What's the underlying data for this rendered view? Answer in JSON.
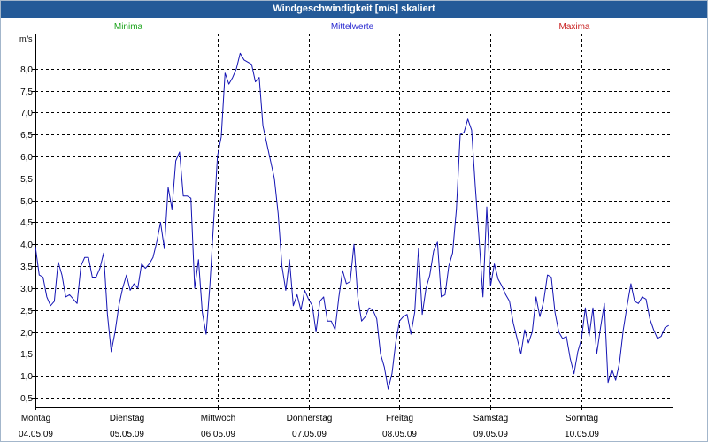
{
  "colors": {
    "title_bar": "#245a98",
    "title_text": "#ffffff",
    "grid": "#000000"
  },
  "chart_data": {
    "type": "line",
    "title": "Windgeschwindigkeit [m/s] skaliert",
    "ylabel": "m/s",
    "grid": true,
    "legend_position": "top",
    "legend": [
      {
        "name": "Minima",
        "color": "#1fa51f"
      },
      {
        "name": "Mittelwerte",
        "color": "#2a2ad0"
      },
      {
        "name": "Maxima",
        "color": "#c82020"
      }
    ],
    "ylim": [
      0.3,
      8.8
    ],
    "yticks": [
      0.5,
      1.0,
      1.5,
      2.0,
      2.5,
      3.0,
      3.5,
      4.0,
      4.5,
      5.0,
      5.5,
      6.0,
      6.5,
      7.0,
      7.5,
      8.0
    ],
    "ytick_labels": [
      "0,5",
      "1,0",
      "1,5",
      "2,0",
      "2,5",
      "3,0",
      "3,5",
      "4,0",
      "4,5",
      "5,0",
      "5,5",
      "6,0",
      "6,5",
      "7,0",
      "7,5",
      "8,0"
    ],
    "xlim": [
      "04.05.09 00:00",
      "11.05.09 00:00"
    ],
    "xticks": [
      {
        "day": "Montag",
        "date": "04.05.09"
      },
      {
        "day": "Dienstag",
        "date": "05.05.09"
      },
      {
        "day": "Mittwoch",
        "date": "06.05.09"
      },
      {
        "day": "Donnerstag",
        "date": "07.05.09"
      },
      {
        "day": "Freitag",
        "date": "08.05.09"
      },
      {
        "day": "Samstag",
        "date": "09.05.09"
      },
      {
        "day": "Sonntag",
        "date": "10.05.09"
      }
    ],
    "x": [
      "04.05.09 00:00",
      "04.05.09 01:00",
      "04.05.09 02:00",
      "04.05.09 03:00",
      "04.05.09 04:00",
      "04.05.09 05:00",
      "04.05.09 06:00",
      "04.05.09 07:00",
      "04.05.09 08:00",
      "04.05.09 09:00",
      "04.05.09 10:00",
      "04.05.09 11:00",
      "04.05.09 12:00",
      "04.05.09 13:00",
      "04.05.09 14:00",
      "04.05.09 15:00",
      "04.05.09 16:00",
      "04.05.09 17:00",
      "04.05.09 18:00",
      "04.05.09 19:00",
      "04.05.09 20:00",
      "04.05.09 21:00",
      "04.05.09 22:00",
      "04.05.09 23:00",
      "05.05.09 00:00",
      "05.05.09 01:00",
      "05.05.09 02:00",
      "05.05.09 03:00",
      "05.05.09 04:00",
      "05.05.09 05:00",
      "05.05.09 06:00",
      "05.05.09 07:00",
      "05.05.09 08:00",
      "05.05.09 09:00",
      "05.05.09 10:00",
      "05.05.09 11:00",
      "05.05.09 12:00",
      "05.05.09 13:00",
      "05.05.09 14:00",
      "05.05.09 15:00",
      "05.05.09 16:00",
      "05.05.09 17:00",
      "05.05.09 18:00",
      "05.05.09 19:00",
      "05.05.09 20:00",
      "05.05.09 21:00",
      "05.05.09 22:00",
      "05.05.09 23:00",
      "06.05.09 00:00",
      "06.05.09 01:00",
      "06.05.09 02:00",
      "06.05.09 03:00",
      "06.05.09 04:00",
      "06.05.09 05:00",
      "06.05.09 06:00",
      "06.05.09 07:00",
      "06.05.09 08:00",
      "06.05.09 09:00",
      "06.05.09 10:00",
      "06.05.09 11:00",
      "06.05.09 12:00",
      "06.05.09 13:00",
      "06.05.09 14:00",
      "06.05.09 15:00",
      "06.05.09 16:00",
      "06.05.09 17:00",
      "06.05.09 18:00",
      "06.05.09 19:00",
      "06.05.09 20:00",
      "06.05.09 21:00",
      "06.05.09 22:00",
      "06.05.09 23:00",
      "07.05.09 00:00",
      "07.05.09 01:00",
      "07.05.09 02:00",
      "07.05.09 03:00",
      "07.05.09 04:00",
      "07.05.09 05:00",
      "07.05.09 06:00",
      "07.05.09 07:00",
      "07.05.09 08:00",
      "07.05.09 09:00",
      "07.05.09 10:00",
      "07.05.09 11:00",
      "07.05.09 12:00",
      "07.05.09 13:00",
      "07.05.09 14:00",
      "07.05.09 15:00",
      "07.05.09 16:00",
      "07.05.09 17:00",
      "07.05.09 18:00",
      "07.05.09 19:00",
      "07.05.09 20:00",
      "07.05.09 21:00",
      "07.05.09 22:00",
      "07.05.09 23:00",
      "08.05.09 00:00",
      "08.05.09 01:00",
      "08.05.09 02:00",
      "08.05.09 03:00",
      "08.05.09 04:00",
      "08.05.09 05:00",
      "08.05.09 06:00",
      "08.05.09 07:00",
      "08.05.09 08:00",
      "08.05.09 09:00",
      "08.05.09 10:00",
      "08.05.09 11:00",
      "08.05.09 12:00",
      "08.05.09 13:00",
      "08.05.09 14:00",
      "08.05.09 15:00",
      "08.05.09 16:00",
      "08.05.09 17:00",
      "08.05.09 18:00",
      "08.05.09 19:00",
      "08.05.09 20:00",
      "08.05.09 21:00",
      "08.05.09 22:00",
      "08.05.09 23:00",
      "09.05.09 00:00",
      "09.05.09 01:00",
      "09.05.09 02:00",
      "09.05.09 03:00",
      "09.05.09 04:00",
      "09.05.09 05:00",
      "09.05.09 06:00",
      "09.05.09 07:00",
      "09.05.09 08:00",
      "09.05.09 09:00",
      "09.05.09 10:00",
      "09.05.09 11:00",
      "09.05.09 12:00",
      "09.05.09 13:00",
      "09.05.09 14:00",
      "09.05.09 15:00",
      "09.05.09 16:00",
      "09.05.09 17:00",
      "09.05.09 18:00",
      "09.05.09 19:00",
      "09.05.09 20:00",
      "09.05.09 21:00",
      "09.05.09 22:00",
      "09.05.09 23:00",
      "10.05.09 00:00",
      "10.05.09 01:00",
      "10.05.09 02:00",
      "10.05.09 03:00",
      "10.05.09 04:00",
      "10.05.09 05:00",
      "10.05.09 06:00",
      "10.05.09 07:00",
      "10.05.09 08:00",
      "10.05.09 09:00",
      "10.05.09 10:00",
      "10.05.09 11:00",
      "10.05.09 12:00",
      "10.05.09 13:00",
      "10.05.09 14:00",
      "10.05.09 15:00",
      "10.05.09 16:00",
      "10.05.09 17:00",
      "10.05.09 18:00",
      "10.05.09 19:00",
      "10.05.09 20:00",
      "10.05.09 21:00",
      "10.05.09 22:00",
      "10.05.09 23:00"
    ],
    "series": [
      {
        "name": "Mittelwerte",
        "color": "#1414b4",
        "values": [
          3.95,
          3.3,
          3.25,
          2.8,
          2.6,
          2.7,
          3.6,
          3.3,
          2.8,
          2.85,
          2.75,
          2.65,
          3.5,
          3.7,
          3.7,
          3.25,
          3.25,
          3.45,
          3.8,
          2.4,
          1.55,
          2.0,
          2.6,
          3.0,
          3.3,
          2.95,
          3.1,
          3.0,
          3.55,
          3.45,
          3.55,
          3.7,
          4.05,
          4.5,
          3.9,
          5.3,
          4.8,
          5.9,
          6.1,
          5.1,
          5.1,
          5.05,
          3.0,
          3.65,
          2.45,
          1.95,
          3.05,
          4.5,
          6.0,
          6.45,
          7.9,
          7.65,
          7.8,
          8.0,
          8.35,
          8.2,
          8.15,
          8.1,
          7.7,
          7.8,
          6.7,
          6.3,
          5.9,
          5.5,
          4.7,
          3.5,
          2.95,
          3.65,
          2.6,
          2.85,
          2.5,
          2.95,
          2.75,
          2.6,
          2.0,
          2.7,
          2.8,
          2.25,
          2.25,
          2.05,
          2.8,
          3.4,
          3.1,
          3.15,
          4.0,
          2.8,
          2.25,
          2.35,
          2.55,
          2.5,
          2.3,
          1.5,
          1.2,
          0.7,
          1.05,
          1.75,
          2.25,
          2.35,
          2.4,
          1.95,
          2.45,
          3.9,
          2.4,
          3.0,
          3.3,
          3.85,
          4.05,
          2.8,
          2.85,
          3.5,
          3.8,
          4.8,
          6.5,
          6.55,
          6.85,
          6.6,
          5.3,
          4.1,
          2.8,
          4.85,
          3.05,
          3.55,
          3.2,
          3.05,
          2.85,
          2.7,
          2.2,
          1.85,
          1.5,
          2.05,
          1.75,
          2.0,
          2.8,
          2.35,
          2.7,
          3.3,
          3.25,
          2.45,
          2.0,
          1.85,
          1.9,
          1.4,
          1.05,
          1.55,
          1.85,
          2.55,
          1.9,
          2.55,
          1.5,
          2.1,
          2.65,
          0.85,
          1.15,
          0.9,
          1.3,
          2.05,
          2.6,
          3.1,
          2.7,
          2.65,
          2.8,
          2.75,
          2.3,
          2.05,
          1.85,
          1.9,
          2.1,
          2.15
        ]
      }
    ]
  }
}
